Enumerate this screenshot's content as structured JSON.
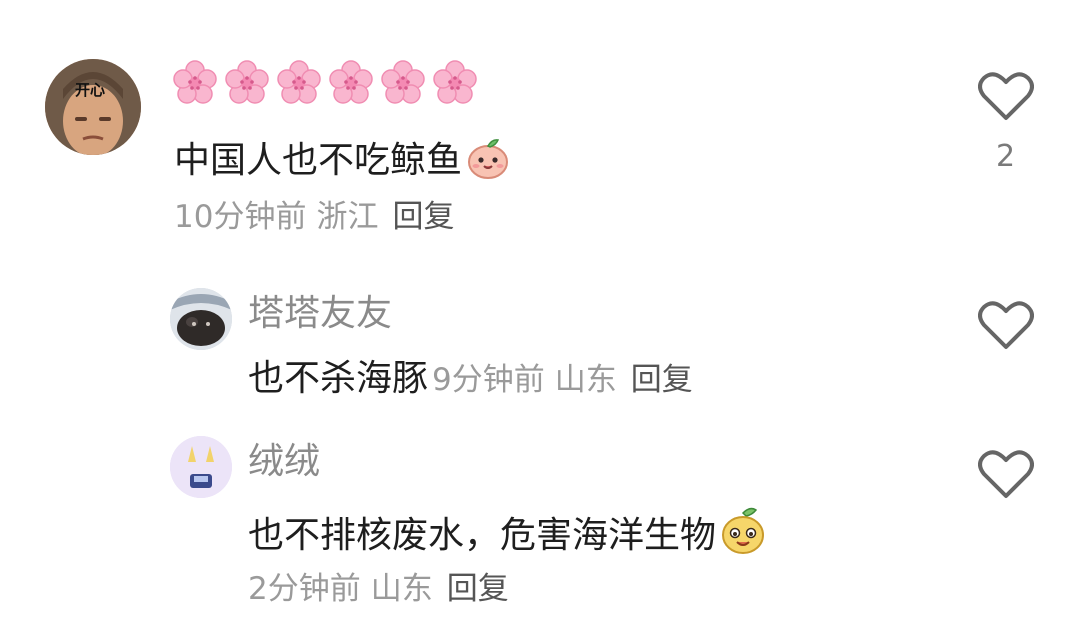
{
  "comments": [
    {
      "avatar_label": "开心",
      "nickname_icons": [
        "cherry-blossom-icon",
        "cherry-blossom-icon",
        "cherry-blossom-icon",
        "cherry-blossom-icon",
        "cherry-blossom-icon",
        "cherry-blossom-icon"
      ],
      "text": "中国人也不吃鲸鱼",
      "emoji": "peach-face-emoji",
      "time": "10分钟前",
      "location": "浙江",
      "reply_label": "回复",
      "like_icon": "heart-outline-icon",
      "like_count": "2"
    }
  ],
  "replies": [
    {
      "nickname": "塔塔友友",
      "text": "也不杀海豚",
      "time": "9分钟前",
      "location": "山东",
      "reply_label": "回复",
      "like_icon": "heart-outline-icon"
    },
    {
      "nickname": "绒绒",
      "text": "也不排核废水，危害海洋生物",
      "emoji": "smiling-mango-face-emoji",
      "time": "2分钟前",
      "location": "山东",
      "reply_label": "回复",
      "like_icon": "heart-outline-icon"
    }
  ],
  "colors": {
    "nickname": "#8a8a8a",
    "meta": "#9a9a9a",
    "reply_action": "#555555",
    "body_text": "#1e1e1e"
  }
}
